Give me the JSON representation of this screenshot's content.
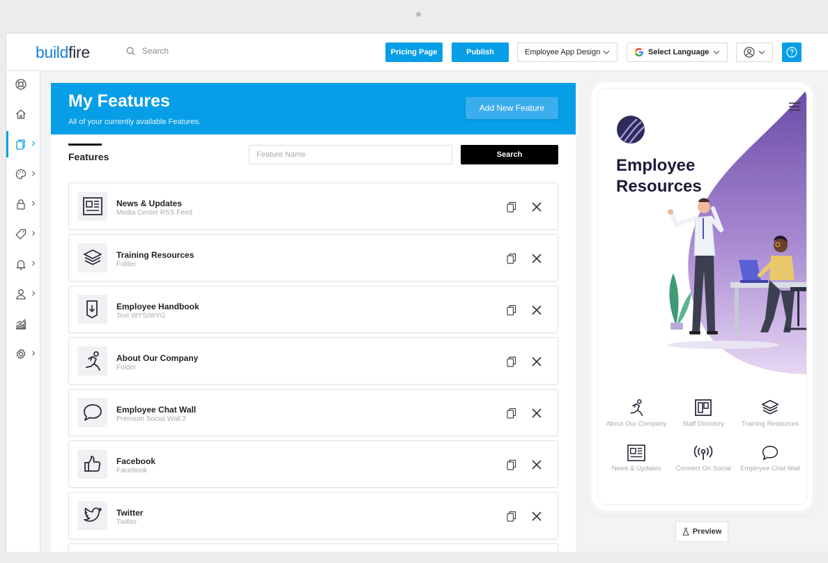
{
  "brand": {
    "logo_part1": "build",
    "logo_part2": "fire",
    "accent": "#069ee6"
  },
  "topbar": {
    "search_label": "Search",
    "pricing_label": "Pricing Page",
    "publish_label": "Publish",
    "app_select": "Employee App Design",
    "language_label": "Select Language"
  },
  "sidebar": {
    "items": [
      {
        "name": "lifebuoy-icon"
      },
      {
        "name": "home-icon"
      },
      {
        "name": "features-copy-icon",
        "active": true
      },
      {
        "name": "palette-icon"
      },
      {
        "name": "lock-icon"
      },
      {
        "name": "tag-icon"
      },
      {
        "name": "bell-icon"
      },
      {
        "name": "user-icon"
      },
      {
        "name": "analytics-icon"
      },
      {
        "name": "gear-icon"
      }
    ]
  },
  "panel": {
    "title": "My Features",
    "subtitle": "All of your currently available Features.",
    "add_label": "Add New Feature",
    "features_heading": "Features",
    "feature_name_placeholder": "Feature Name",
    "search_label": "Search",
    "features": [
      {
        "name": "News & Updates",
        "type": "Media Center RSS Feed",
        "icon": "news-icon"
      },
      {
        "name": "Training Resources",
        "type": "Folder",
        "icon": "layers-icon"
      },
      {
        "name": "Employee Handbook",
        "type": "Text WYSIWYG",
        "icon": "handbook-icon"
      },
      {
        "name": "About Our Company",
        "type": "Folder",
        "icon": "runner-icon"
      },
      {
        "name": "Employee Chat Wall",
        "type": "Premium Social Wall 2",
        "icon": "chat-icon"
      },
      {
        "name": "Facebook",
        "type": "Facebook",
        "icon": "thumbs-up-icon"
      },
      {
        "name": "Twitter",
        "type": "Twitter",
        "icon": "twitter-icon"
      }
    ]
  },
  "phone": {
    "title_line1": "Employee",
    "title_line2": "Resources",
    "grid": [
      {
        "label": "About Our Company",
        "icon": "runner-icon"
      },
      {
        "label": "Staff Directory",
        "icon": "directory-icon"
      },
      {
        "label": "Training Resources",
        "icon": "layers-icon"
      },
      {
        "label": "News & Updates",
        "icon": "news-icon"
      },
      {
        "label": "Connect On Social",
        "icon": "broadcast-icon"
      },
      {
        "label": "Employee Chat Wall",
        "icon": "chat-icon"
      }
    ]
  },
  "preview_label": "Preview"
}
